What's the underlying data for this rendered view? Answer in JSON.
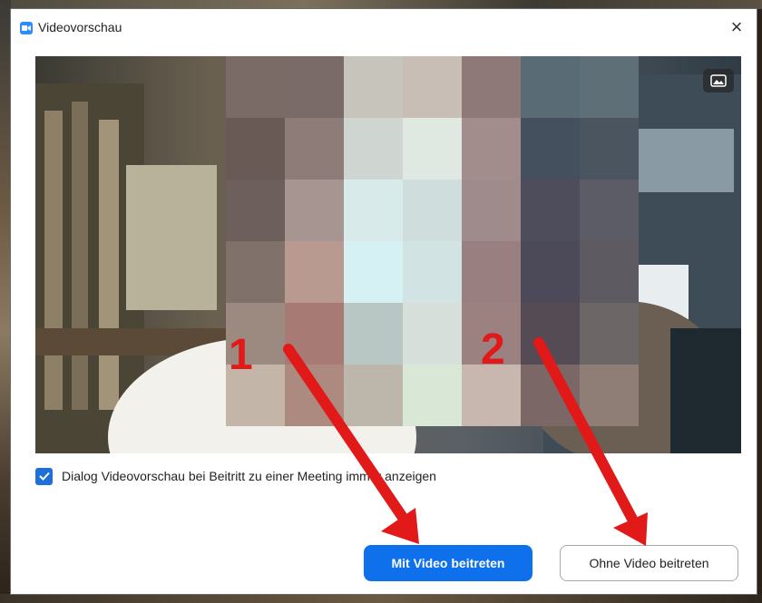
{
  "window": {
    "title": "Videovorschau",
    "close_symbol": "×",
    "app_icon": "zoom-video-icon"
  },
  "preview": {
    "toggle_icon": "background-image-icon"
  },
  "options": {
    "always_show_preview_label": "Dialog Videovorschau bei Beitritt zu einer Meeting immer anzeigen",
    "always_show_preview_checked": true
  },
  "actions": {
    "join_with_video_label": "Mit Video beitreten",
    "join_without_video_label": "Ohne Video beitreten"
  },
  "annotations": {
    "marker_1": "1",
    "marker_2": "2",
    "arrow_color": "#e11919"
  },
  "colors": {
    "primary_button": "#0e71eb",
    "checkbox": "#1f6fd8"
  }
}
